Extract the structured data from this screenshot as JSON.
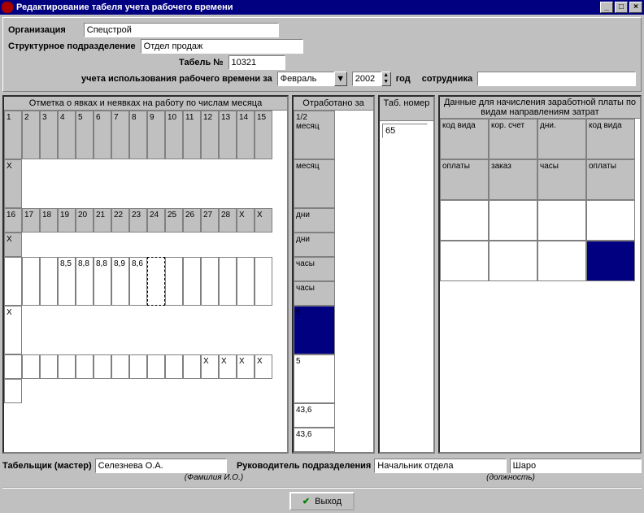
{
  "window": {
    "title": "Редактирование табеля учета рабочего времени"
  },
  "header": {
    "org_label": "Организация",
    "org_value": "Спецстрой",
    "dept_label": "Структурное подразделение",
    "dept_value": "Отдел продаж",
    "tabel_no_label": "Табель №",
    "tabel_no_value": "10321",
    "period_label": "учета использования рабочего времени за",
    "month_value": "Февраль",
    "year_value": "2002",
    "year_suffix": "год",
    "employee_label": "сотрудника",
    "employee_value": ""
  },
  "marks": {
    "header": "Отметка о явках и неявках на работу по числам месяца",
    "row1": [
      "1",
      "2",
      "3",
      "4",
      "5",
      "6",
      "7",
      "8",
      "9",
      "10",
      "11",
      "12",
      "13",
      "14",
      "15",
      "X"
    ],
    "row2": [
      "16",
      "17",
      "18",
      "19",
      "20",
      "21",
      "22",
      "23",
      "24",
      "25",
      "26",
      "27",
      "28",
      "X",
      "X",
      "X"
    ],
    "row3": [
      "",
      "",
      "",
      "8,5",
      "8,8",
      "8,8",
      "8,9",
      "8,6",
      "",
      "",
      "",
      "",
      "",
      "",
      "",
      "X"
    ],
    "row4": [
      "",
      "",
      "",
      "",
      "",
      "",
      "",
      "",
      "",
      "",
      "",
      "X",
      "X",
      "X",
      "X",
      ""
    ]
  },
  "worked": {
    "header": "Отработано за",
    "cols1": [
      "1/2 месяц",
      "месяц"
    ],
    "cols2": [
      "дни",
      "дни"
    ],
    "cols3": [
      "часы",
      "часы"
    ],
    "vals1": [
      "5",
      "5"
    ],
    "vals2": [
      "43,6",
      "43,6"
    ]
  },
  "tabnum": {
    "header": "Таб. номер",
    "value": "65"
  },
  "payroll": {
    "header": "Данные для начисления заработной платы по видам направлениям затрат",
    "h1": [
      "код вида",
      "кор. счет",
      "дни.",
      "код вида"
    ],
    "h2": [
      "оплаты",
      "заказ",
      "часы",
      "оплаты"
    ]
  },
  "footer": {
    "tabper_label": "Табельщик (мастер)",
    "tabper_value": "Селезнева О.А.",
    "tabper_hint": "(Фамилия И.О.)",
    "head_label": "Руководитель подразделения",
    "head_value": "Начальник отдела",
    "head_hint": "(должность)",
    "head2_value": "Шаро",
    "exit_label": "Выход"
  }
}
